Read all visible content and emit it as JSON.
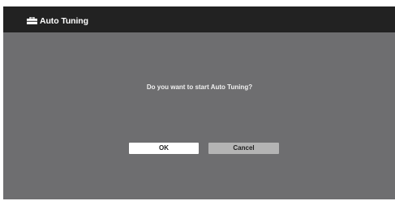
{
  "header": {
    "icon": "toolbox-icon",
    "title": "Auto Tuning"
  },
  "dialog": {
    "message": "Do you want to start Auto Tuning?",
    "ok_label": "OK",
    "cancel_label": "Cancel"
  },
  "colors": {
    "background": "#6e6e70",
    "header": "#222222",
    "ok_button": "#ffffff",
    "cancel_button": "#b4b4b4"
  }
}
